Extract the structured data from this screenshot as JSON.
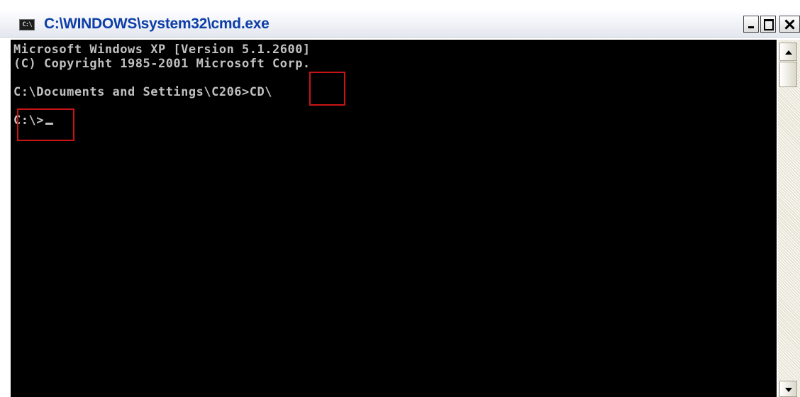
{
  "window": {
    "title": "C:\\WINDOWS\\system32\\cmd.exe",
    "icon": "cmd-console-icon",
    "icon_label": "C:\\",
    "controls": [
      "minimize-icon",
      "maximize-icon",
      "close-icon"
    ]
  },
  "console": {
    "lines": [
      "Microsoft Windows XP [Version 5.1.2600]",
      "(C) Copyright 1985-2001 Microsoft Corp.",
      "C:\\Documents and Settings\\C206>CD\\",
      "C:\\>"
    ],
    "text_color": "#c0c0c0",
    "background_color": "#000000"
  },
  "annotations": {
    "highlight_color": "#c81414",
    "highlighted": [
      "CD\\",
      "C:\\>"
    ]
  },
  "scrollbar": {
    "up_icon": "scroll-up-arrow-icon",
    "down_icon": "scroll-down-arrow-icon"
  }
}
